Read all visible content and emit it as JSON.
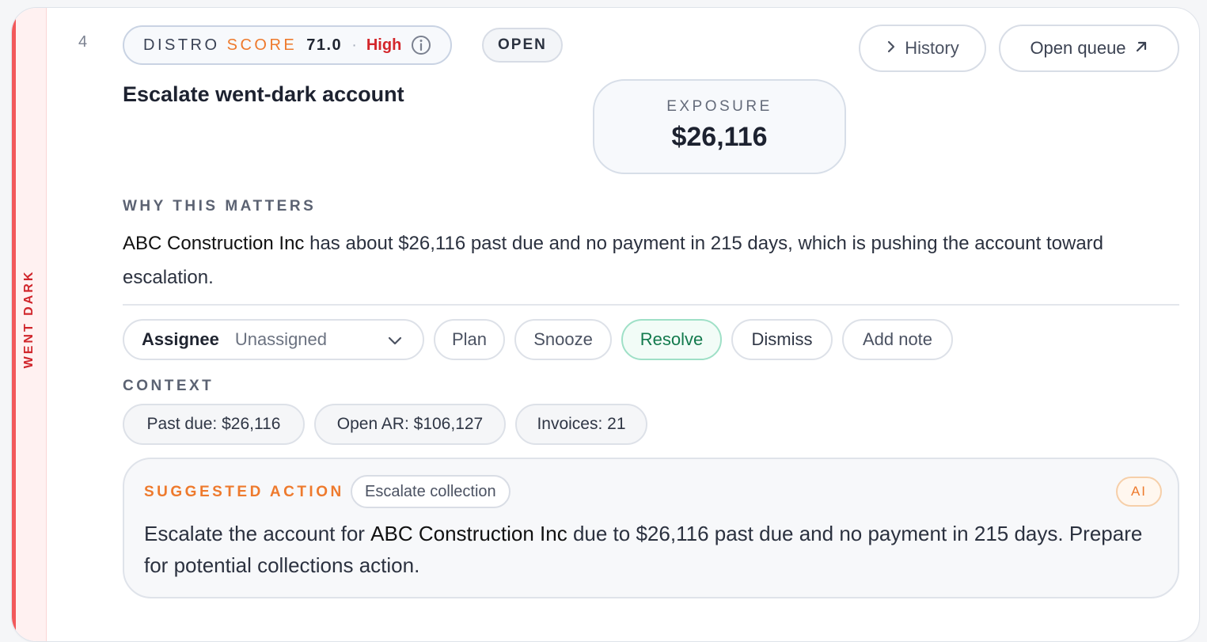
{
  "rail": {
    "label": "WENT DARK",
    "color": "#f2585a"
  },
  "rank": "4",
  "score": {
    "label_prefix": "DISTRO ",
    "label_accent": "SCORE",
    "value": "71.0",
    "separator": "·",
    "level": "High",
    "info_icon": "info-circle-icon"
  },
  "status": "OPEN",
  "actions": {
    "history": "History",
    "history_icon": "chevron-right-icon",
    "open_queue": "Open queue",
    "open_queue_icon": "arrow-up-right-icon"
  },
  "title": "Escalate went-dark account",
  "exposure": {
    "label": "EXPOSURE",
    "value": "$26,116"
  },
  "why": {
    "label": "WHY THIS MATTERS",
    "company": "ABC Construction Inc",
    "text": " has about $26,116 past due and no payment in 215 days, which is pushing the account toward escalation."
  },
  "controls": {
    "assignee_label": "Assignee",
    "assignee_value": "Unassigned",
    "plan": "Plan",
    "snooze": "Snooze",
    "resolve": "Resolve",
    "dismiss": "Dismiss",
    "add_note": "Add note"
  },
  "context": {
    "label": "CONTEXT",
    "chips": [
      "Past due: $26,116",
      "Open AR: $106,127",
      "Invoices: 21"
    ]
  },
  "suggestion": {
    "label": "SUGGESTED ACTION",
    "tag": "Escalate collection",
    "badge": "AI",
    "text_before": "Escalate the account for ",
    "company": "ABC Construction Inc",
    "text_after": "  due to $26,116 past due and no payment in 215 days. Prepare for potential collections action."
  },
  "colors": {
    "accent": "#ee7a2d",
    "danger": "#d3262b",
    "success": "#137a4d"
  }
}
